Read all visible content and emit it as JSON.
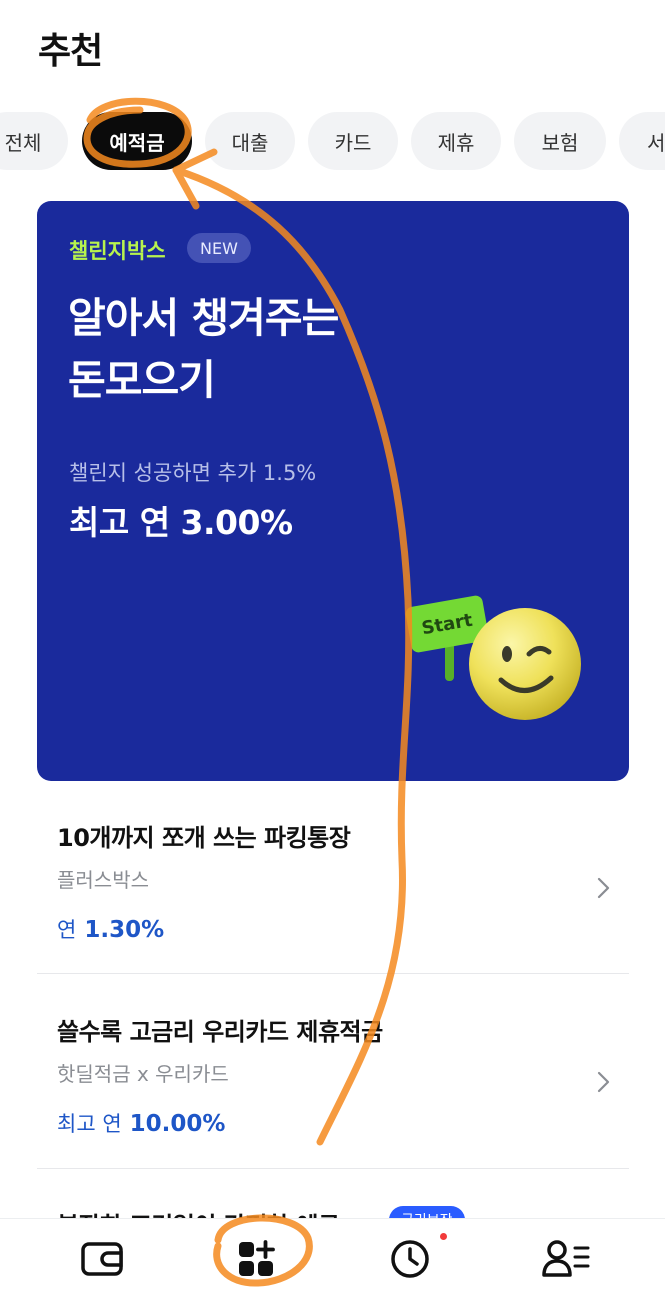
{
  "header": {
    "title": "추천"
  },
  "chips": [
    {
      "label": "전체",
      "active": false
    },
    {
      "label": "예적금",
      "active": true
    },
    {
      "label": "대출",
      "active": false
    },
    {
      "label": "카드",
      "active": false
    },
    {
      "label": "제휴",
      "active": false
    },
    {
      "label": "보험",
      "active": false
    },
    {
      "label": "서",
      "active": false
    }
  ],
  "banner": {
    "tag": "챌린지박스",
    "badge": "NEW",
    "headline_line1": "알아서 챙겨주는",
    "headline_line2": "돈모으기",
    "sub": "챌린지 성공하면 추가 1.5%",
    "rate": "최고 연 3.00%",
    "sign_text": "Start",
    "color": "#1a2a9c",
    "tag_color": "#b7f34e"
  },
  "products": [
    {
      "title": "10개까지 쪼개 쓰는 파킹통장",
      "sub": "플러스박스",
      "rate_prefix": "연",
      "rate_value": "1.30%"
    },
    {
      "title": "쓸수록 고금리 우리카드 제휴적금",
      "sub": "핫딜적금 x 우리카드",
      "rate_prefix": "최고 연",
      "rate_value": "10.00%"
    }
  ],
  "partial_product": {
    "title": "복잡한 조건없이 간편한 예금",
    "badge": "금리보장"
  },
  "tabbar": {
    "items": [
      {
        "icon": "wallet-icon"
      },
      {
        "icon": "apps-add-icon"
      },
      {
        "icon": "clock-icon"
      },
      {
        "icon": "profile-menu-icon"
      }
    ]
  },
  "accent_color": "#1e56c7",
  "annotation_color": "#f58a1f"
}
